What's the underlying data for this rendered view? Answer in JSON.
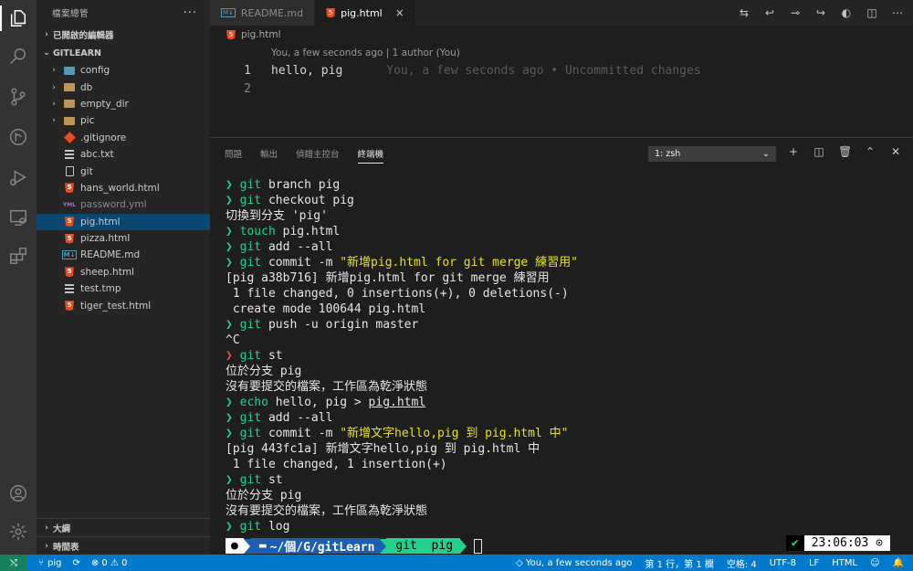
{
  "sidebar": {
    "title": "檔案總管",
    "open_editors": "已開啟的編輯器",
    "project": "GITLEARN",
    "items": [
      {
        "label": "config",
        "type": "folder-config",
        "chev": "›"
      },
      {
        "label": "db",
        "type": "folder",
        "chev": "›"
      },
      {
        "label": "empty_dir",
        "type": "folder",
        "chev": "›"
      },
      {
        "label": "pic",
        "type": "folder",
        "chev": "›"
      },
      {
        "label": ".gitignore",
        "type": "git"
      },
      {
        "label": "abc.txt",
        "type": "lines"
      },
      {
        "label": "git",
        "type": "doc"
      },
      {
        "label": "hans_world.html",
        "type": "html"
      },
      {
        "label": "password.yml",
        "type": "yml"
      },
      {
        "label": "pig.html",
        "type": "html"
      },
      {
        "label": "pizza.html",
        "type": "html"
      },
      {
        "label": "README.md",
        "type": "md"
      },
      {
        "label": "sheep.html",
        "type": "html"
      },
      {
        "label": "test.tmp",
        "type": "lines"
      },
      {
        "label": "tiger_test.html",
        "type": "html"
      }
    ],
    "outline": "大綱",
    "timeline": "時間表"
  },
  "tabs": [
    {
      "label": "README.md",
      "icon": "md"
    },
    {
      "label": "pig.html",
      "icon": "html",
      "close": "×"
    }
  ],
  "breadcrumb": "pig.html",
  "editor": {
    "codelens": "You, a few seconds ago | 1 author (You)",
    "lines": [
      {
        "num": "1",
        "text": "hello, pig",
        "blame": "You, a few seconds ago • Uncommitted changes"
      },
      {
        "num": "2",
        "text": "",
        "blame": ""
      }
    ]
  },
  "panel": {
    "tabs": [
      "問題",
      "輸出",
      "偵錯主控台",
      "終端機"
    ],
    "terminal_select": "1: zsh"
  },
  "terminal": {
    "lines": [
      {
        "p": "❯",
        "c": "git",
        "rest": " branch pig"
      },
      {
        "p": "❯",
        "c": "git",
        "rest": " checkout pig"
      },
      {
        "out": "切換到分支 'pig'"
      },
      {
        "p": "❯",
        "c": "touch",
        "rest": " pig.html"
      },
      {
        "p": "❯",
        "c": "git",
        "rest": " add --all"
      },
      {
        "p": "❯",
        "c": "git",
        "rest": " commit -m ",
        "str": "\"新增pig.html for git merge 練習用\""
      },
      {
        "out": "[pig a38b716] 新增pig.html for git merge 練習用"
      },
      {
        "out": " 1 file changed, 0 insertions(+), 0 deletions(-)"
      },
      {
        "out": " create mode 100644 pig.html"
      },
      {
        "p": "❯",
        "c": "git",
        "rest": " push -u origin master"
      },
      {
        "out": "^C"
      },
      {
        "p": "❯",
        "red": true,
        "c": "git",
        "rest": " st"
      },
      {
        "out": "位於分支 pig"
      },
      {
        "out": "沒有要提交的檔案，工作區為乾淨狀態"
      },
      {
        "p": "❯",
        "c": "echo",
        "rest": " hello, pig > ",
        "ul": "pig.html"
      },
      {
        "p": "❯",
        "c": "git",
        "rest": " add --all"
      },
      {
        "p": "❯",
        "c": "git",
        "rest": " commit -m ",
        "str": "\"新增文字hello,pig 到 pig.html 中\""
      },
      {
        "out": "[pig 443fc1a] 新增文字hello,pig 到 pig.html 中"
      },
      {
        "out": " 1 file changed, 1 insertion(+)"
      },
      {
        "p": "❯",
        "c": "git",
        "rest": " st"
      },
      {
        "out": "位於分支 pig"
      },
      {
        "out": "沒有要提交的檔案，工作區為乾淨狀態"
      },
      {
        "p": "❯",
        "c": "git",
        "rest": " log"
      }
    ],
    "prompt_apple": "",
    "prompt_path": "~/個/G/gitLearn",
    "prompt_branch": "git  pig",
    "status_ok": "✔",
    "time": "23:06:03 ⊙"
  },
  "statusbar": {
    "branch": "pig",
    "problems": "⊗ 0 ⚠ 0",
    "blame": "You, a few seconds ago",
    "position": "第 1 行，第 1 欄",
    "spaces": "空格: 4",
    "encoding": "UTF-8",
    "eol": "LF",
    "language": "HTML"
  }
}
